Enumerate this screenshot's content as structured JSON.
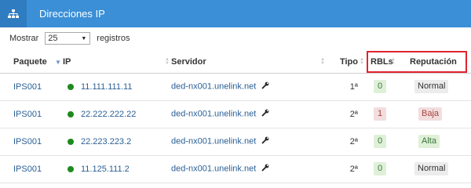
{
  "panel": {
    "title": "Direcciones IP",
    "icon": "sitemap-icon"
  },
  "length": {
    "prefix": "Mostrar",
    "value": "25",
    "suffix": "registros"
  },
  "columns": {
    "paquete": "Paquete",
    "ip": "IP",
    "servidor": "Servidor",
    "tipo": "Tipo",
    "rbls": "RBLs",
    "reputacion": "Reputación"
  },
  "rows": [
    {
      "paquete": "IPS001",
      "ip": "11.111.111.11",
      "servidor": "ded-nx001.unelink.net",
      "tipo": "1ª",
      "rbls": "0",
      "reputacion": "Normal"
    },
    {
      "paquete": "IPS001",
      "ip": "22.222.222.22",
      "servidor": "ded-nx001.unelink.net",
      "tipo": "2ª",
      "rbls": "1",
      "reputacion": "Baja"
    },
    {
      "paquete": "IPS001",
      "ip": "22.223.223.2",
      "servidor": "ded-nx001.unelink.net",
      "tipo": "2ª",
      "rbls": "0",
      "reputacion": "Alta"
    },
    {
      "paquete": "IPS001",
      "ip": "11.125.111.2",
      "servidor": "ded-nx001.unelink.net",
      "tipo": "2ª",
      "rbls": "0",
      "reputacion": "Normal"
    }
  ],
  "colors": {
    "header": "#3a8fd6",
    "status_dot": "#1e8a1e",
    "highlight_box": "#e0232f"
  }
}
